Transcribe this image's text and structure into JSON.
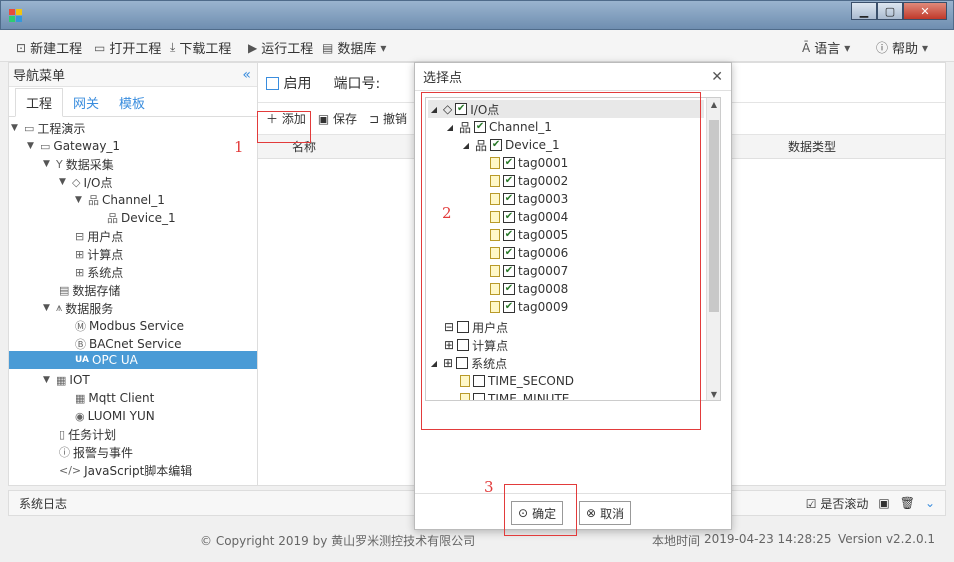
{
  "window": {
    "controls": [
      "minimize",
      "maximize",
      "close"
    ]
  },
  "toolbar": {
    "new_project": "新建工程",
    "open_project": "打开工程",
    "download_project": "下载工程",
    "run_project": "运行工程",
    "database": "数据库",
    "language": "语言",
    "help": "帮助"
  },
  "sidebar": {
    "title": "导航菜单",
    "tabs": [
      "工程",
      "网关",
      "模板"
    ],
    "tree": [
      {
        "label": "工程演示"
      },
      {
        "label": "Gateway_1"
      },
      {
        "label": "数据采集"
      },
      {
        "label": "I/O点"
      },
      {
        "label": "Channel_1"
      },
      {
        "label": "Device_1"
      },
      {
        "label": "用户点"
      },
      {
        "label": "计算点"
      },
      {
        "label": "系统点"
      },
      {
        "label": "数据存储"
      },
      {
        "label": "数据服务"
      },
      {
        "label": "Modbus Service"
      },
      {
        "label": "BACnet Service"
      },
      {
        "label": "OPC UA",
        "selected": true
      },
      {
        "label": "IOT"
      },
      {
        "label": "Mqtt Client"
      },
      {
        "label": "LUOMI YUN"
      },
      {
        "label": "任务计划"
      },
      {
        "label": "报警与事件"
      },
      {
        "label": "JavaScript脚本编辑"
      }
    ],
    "ua_badge": "UA"
  },
  "main": {
    "enable_label": "启用",
    "port_label": "端口号:",
    "add": "添加",
    "save": "保存",
    "undo": "撤销",
    "col_name": "名称",
    "col_type": "数据类型"
  },
  "annotations": {
    "a1": "1",
    "a2": "2",
    "a3": "3"
  },
  "dialog": {
    "title": "选择点",
    "tree": {
      "io": "I/O点",
      "channel": "Channel_1",
      "device": "Device_1",
      "tags": [
        "tag0001",
        "tag0002",
        "tag0003",
        "tag0004",
        "tag0005",
        "tag0006",
        "tag0007",
        "tag0008",
        "tag0009"
      ],
      "user": "用户点",
      "calc": "计算点",
      "system": "系统点",
      "sys_items": [
        "TIME_SECOND",
        "TIME_MINUTE"
      ]
    },
    "ok": "确定",
    "cancel": "取消"
  },
  "log": {
    "title": "系统日志",
    "autoscroll": "是否滚动"
  },
  "footer": {
    "copyright": "© Copyright 2019 by 黄山罗米测控技术有限公司",
    "time_label": "本地时间",
    "time": "2019-04-23 14:28:25",
    "version": "Version v2.2.0.1"
  },
  "colors": {
    "accent": "#3a8dde",
    "selection": "#4a9bd6",
    "annotation": "#e23b3b"
  }
}
